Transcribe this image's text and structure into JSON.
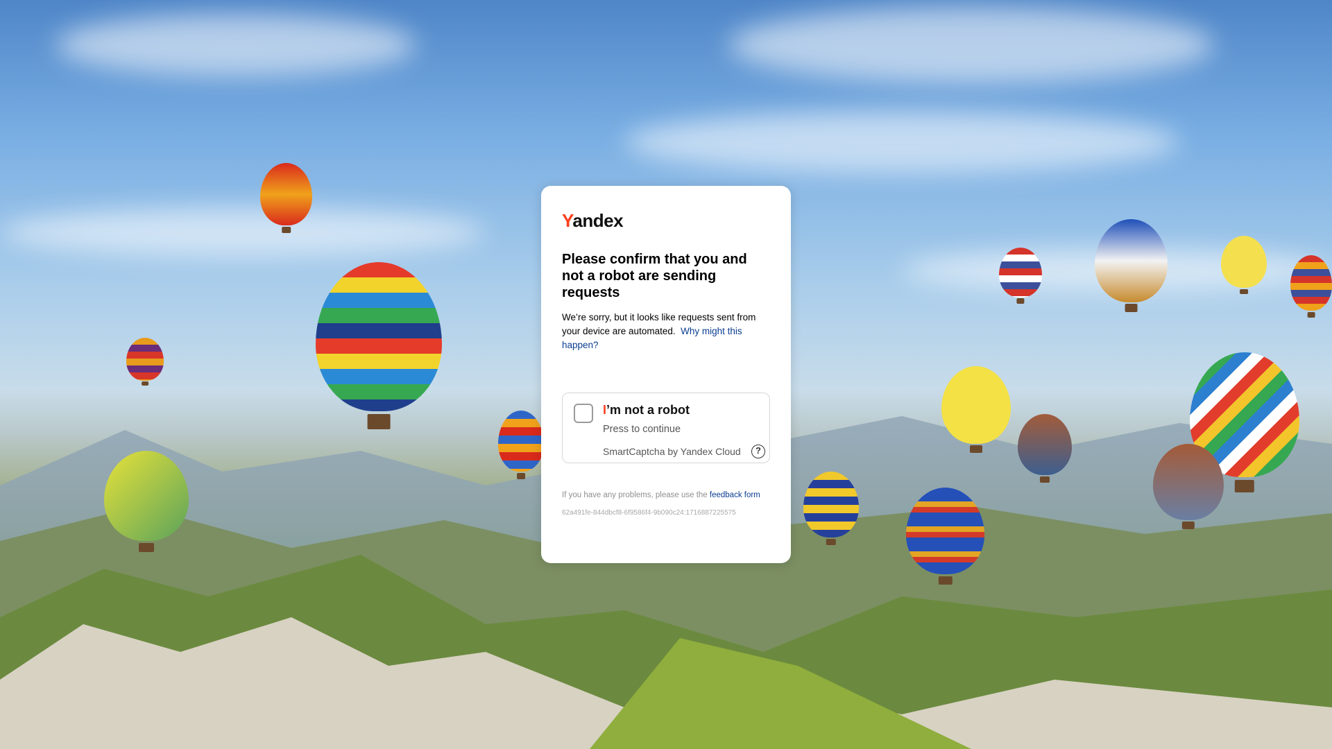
{
  "brand": {
    "logo_first": "Y",
    "logo_rest": "andex"
  },
  "heading": "Please confirm that you and not a robot are sending requests",
  "description": {
    "text": "We’re sorry, but it looks like requests sent from your device are automated.",
    "link": "Why might this happen?"
  },
  "captcha": {
    "checkbox_checked": false,
    "label_first": "I",
    "label_rest": "’m not a robot",
    "hint": "Press to continue",
    "brand": "SmartCaptcha by Yandex Cloud",
    "help_icon": "question-circle-icon"
  },
  "feedback": {
    "text": "If you have any problems, please use the",
    "link": "feedback form"
  },
  "request_id": "62a491fe-844dbcf8-6f9586f4-9b090c24:1716887225575",
  "colors": {
    "accent": "#fc3f1d",
    "link": "#0a3d91",
    "card": "#ffffff"
  }
}
